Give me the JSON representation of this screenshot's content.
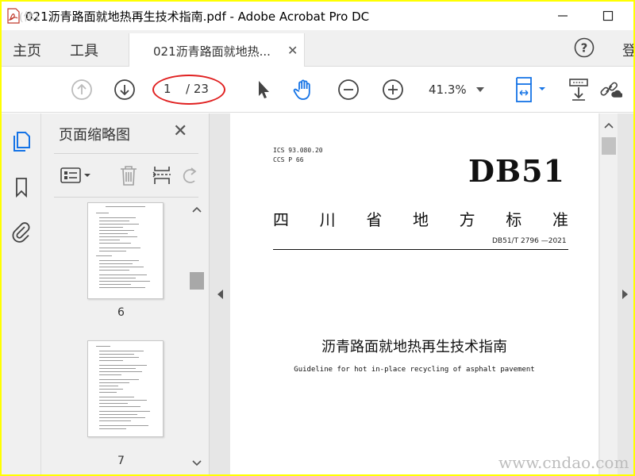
{
  "titlebar": {
    "title": "021沥青路面就地热再生技术指南.pdf - Adobe Acrobat Pro DC",
    "watermark": "(体)"
  },
  "menubar": {
    "home": "主页",
    "tools": "工具",
    "doc_tab": "021沥青路面就地热...",
    "login": "登"
  },
  "toolbar": {
    "page_current": "1",
    "page_total": "/ 23",
    "zoom": "41.3%"
  },
  "colors": {
    "accent": "#1473e6",
    "annotation_ellipse": "#e02020",
    "frame_border": "#ffff00"
  },
  "panel": {
    "title": "页面缩略图",
    "thumbnails": [
      {
        "label": "6"
      },
      {
        "label": "7"
      }
    ]
  },
  "document": {
    "ics": "ICS 93.080.20",
    "ccs": "CCS P 66",
    "code": "DB51",
    "standard_title_chars": [
      "四",
      "川",
      "省",
      "地",
      "方",
      "标",
      "准"
    ],
    "standard_number": "DB51/T 2796 —2021",
    "title_cn": "沥青路面就地热再生技术指南",
    "title_en": "Guideline for hot in-place recycling of asphalt pavement",
    "site_watermark": "www.cndao.com"
  },
  "icons": [
    "pdf-app-icon",
    "minimize-icon",
    "maximize-icon",
    "help-icon",
    "page-up-icon",
    "page-down-icon",
    "select-arrow-icon",
    "hand-tool-icon",
    "zoom-out-icon",
    "zoom-in-icon",
    "fit-page-icon",
    "scroll-mode-icon",
    "share-link-icon",
    "thumbnails-icon",
    "bookmark-icon",
    "attachment-icon",
    "thumbnail-options-icon",
    "delete-icon",
    "insert-page-icon",
    "rotate-icon"
  ]
}
